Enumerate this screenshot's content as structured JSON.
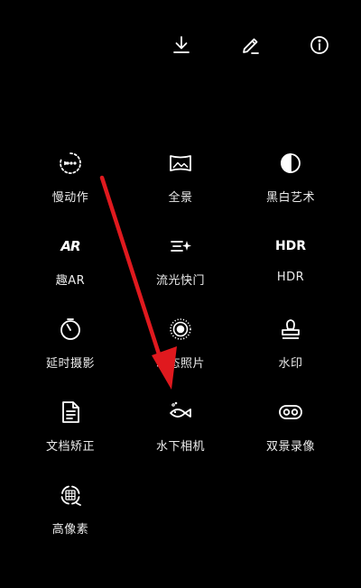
{
  "toolbar": {
    "download_icon": "download-icon",
    "edit_icon": "edit-pencil-icon",
    "info_icon": "info-icon"
  },
  "modes": [
    {
      "label": "慢动作",
      "icon": "slow-motion-icon"
    },
    {
      "label": "全景",
      "icon": "panorama-icon"
    },
    {
      "label": "黑白艺术",
      "icon": "monochrome-icon"
    },
    {
      "label": "趣AR",
      "icon": "ar-icon",
      "icon_text": "AR"
    },
    {
      "label": "流光快门",
      "icon": "light-painting-icon"
    },
    {
      "label": "HDR",
      "icon": "hdr-icon",
      "icon_text": "HDR"
    },
    {
      "label": "延时摄影",
      "icon": "time-lapse-icon"
    },
    {
      "label": "动态照片",
      "icon": "moving-picture-icon"
    },
    {
      "label": "水印",
      "icon": "watermark-stamp-icon"
    },
    {
      "label": "文档矫正",
      "icon": "document-icon"
    },
    {
      "label": "水下相机",
      "icon": "underwater-fish-icon"
    },
    {
      "label": "双景录像",
      "icon": "dual-view-icon"
    },
    {
      "label": "高像素",
      "icon": "high-resolution-icon"
    }
  ],
  "annotation": {
    "arrow_color": "#e0191e"
  }
}
